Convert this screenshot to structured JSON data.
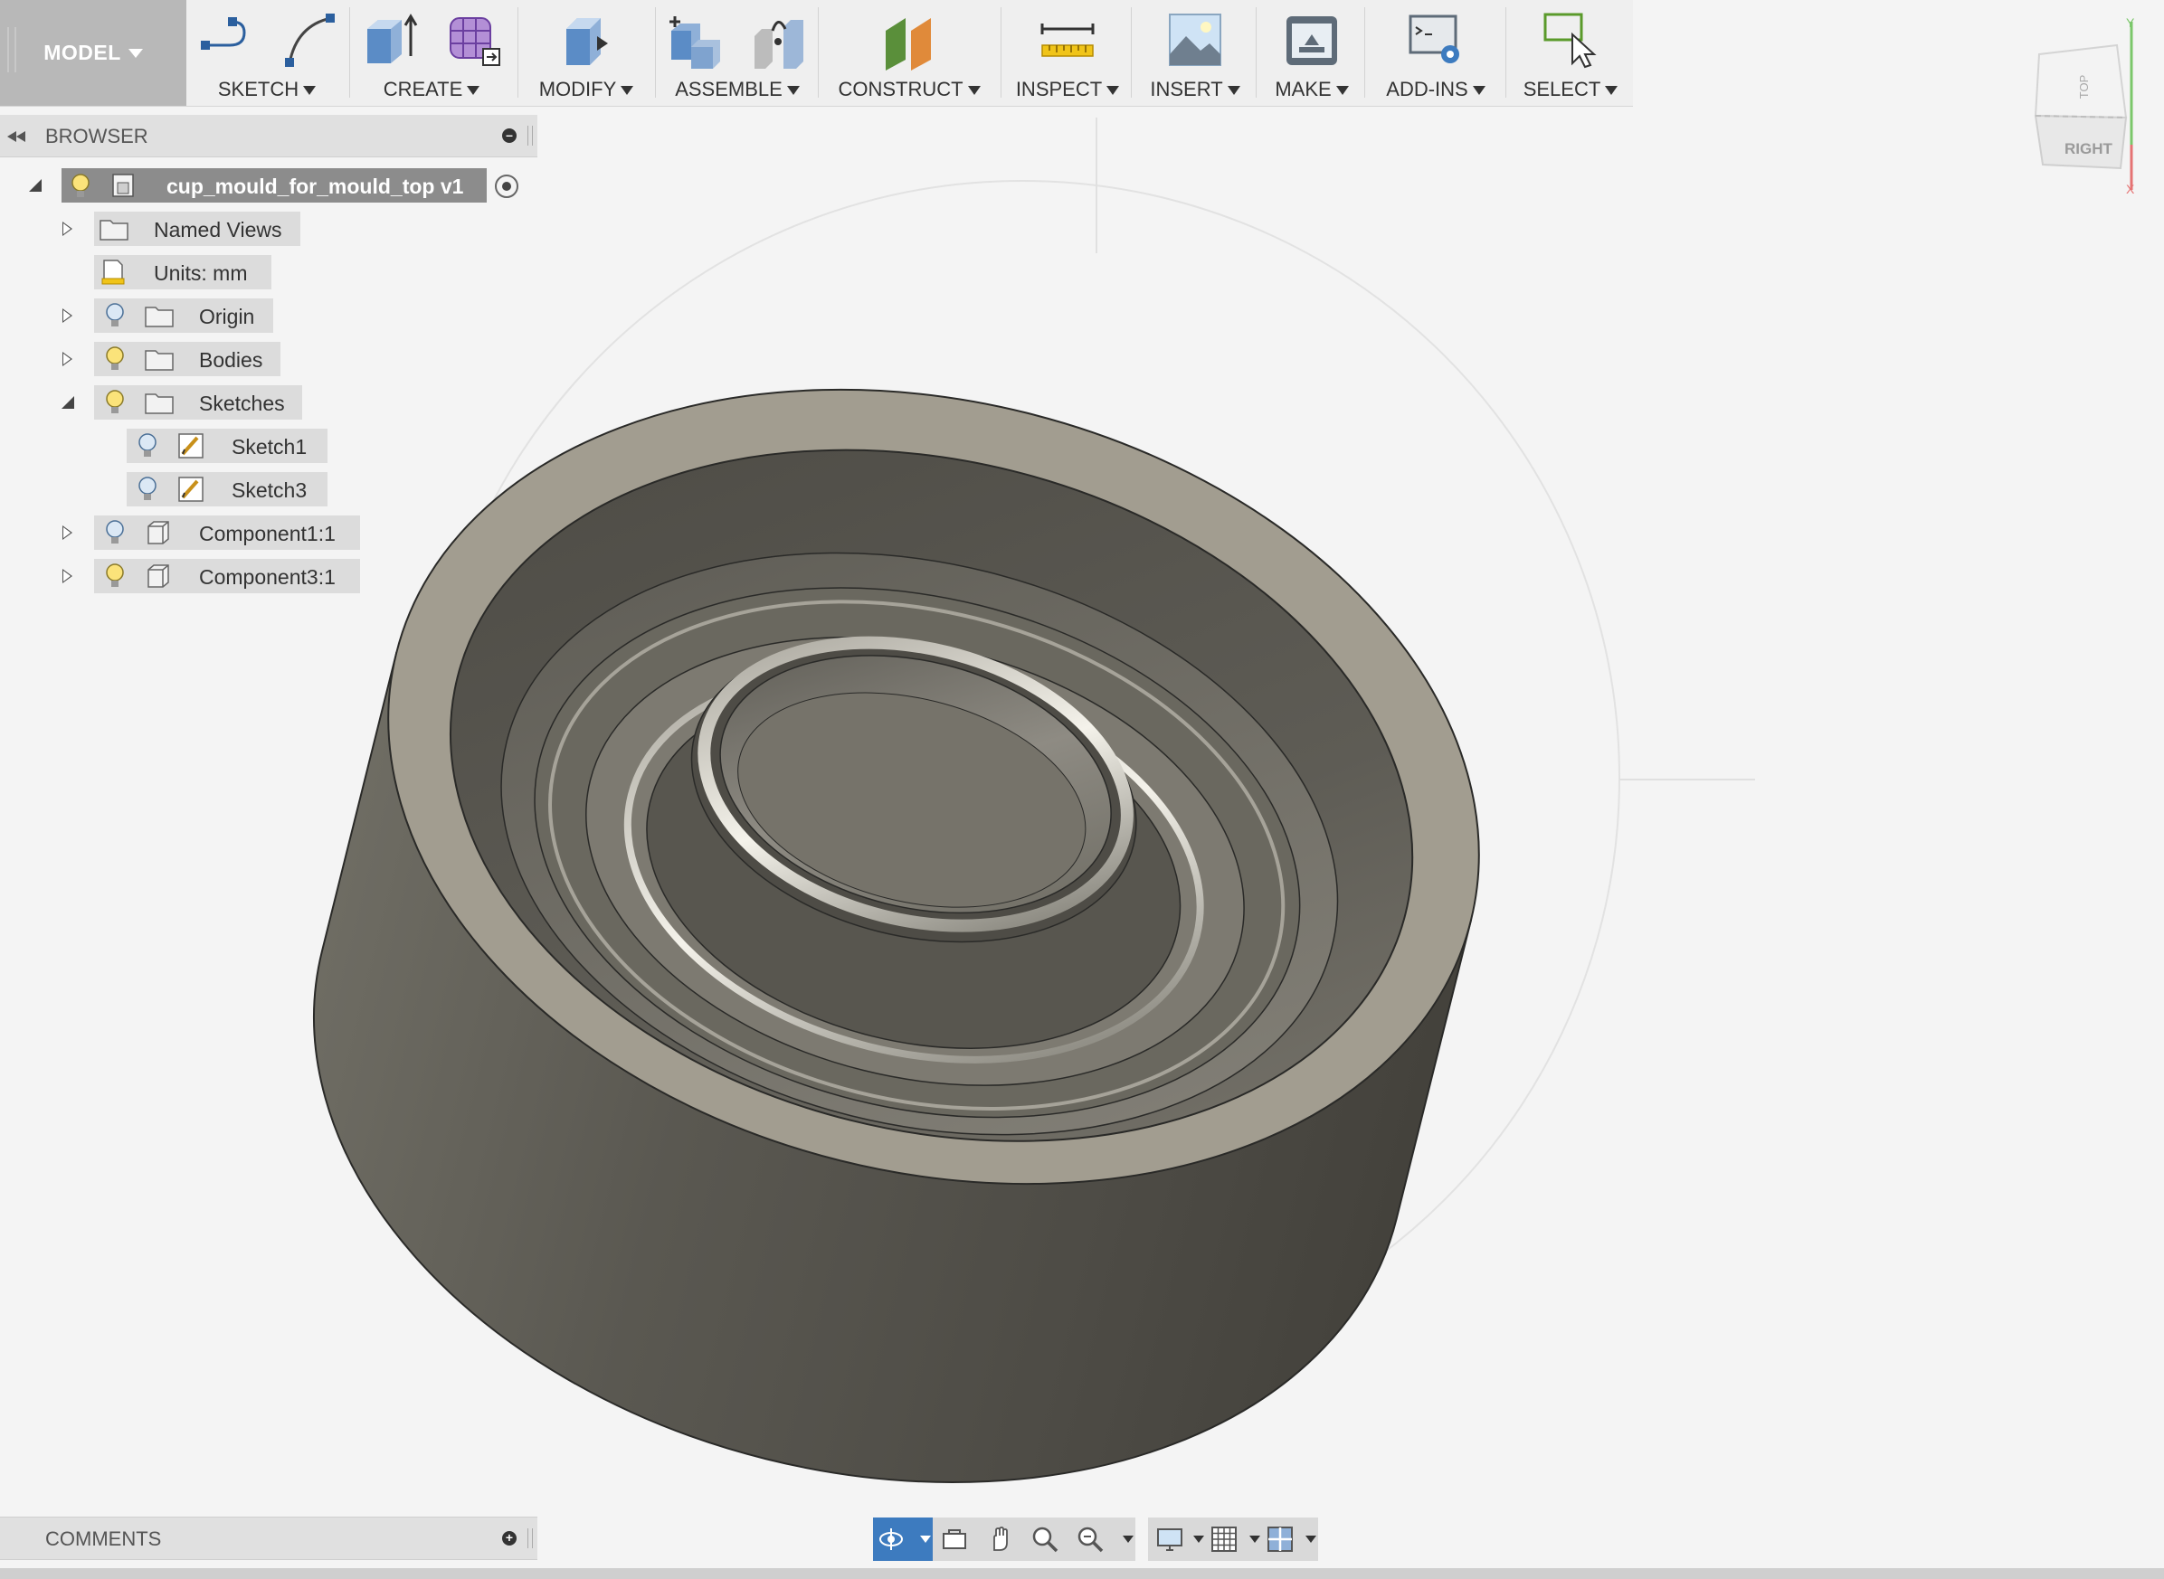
{
  "toolbar": {
    "model_label": "MODEL",
    "groups": [
      {
        "label": "SKETCH",
        "icons": [
          "line-icon",
          "arc-icon"
        ]
      },
      {
        "label": "CREATE",
        "icons": [
          "extrude-icon",
          "form-icon"
        ]
      },
      {
        "label": "MODIFY",
        "icons": [
          "press-pull-icon"
        ]
      },
      {
        "label": "ASSEMBLE",
        "icons": [
          "new-component-icon",
          "joint-icon"
        ]
      },
      {
        "label": "CONSTRUCT",
        "icons": [
          "offset-plane-icon"
        ]
      },
      {
        "label": "INSPECT",
        "icons": [
          "measure-icon"
        ]
      },
      {
        "label": "INSERT",
        "icons": [
          "insert-image-icon"
        ]
      },
      {
        "label": "MAKE",
        "icons": [
          "3d-print-icon"
        ]
      },
      {
        "label": "ADD-INS",
        "icons": [
          "scripts-icon"
        ]
      },
      {
        "label": "SELECT",
        "icons": [
          "select-icon"
        ]
      }
    ]
  },
  "browser": {
    "title": "BROWSER",
    "root": {
      "label": "cup_mould_for_mould_top v1"
    },
    "items": [
      {
        "label": "Named Views"
      },
      {
        "label": "Units: mm"
      },
      {
        "label": "Origin"
      },
      {
        "label": "Bodies"
      },
      {
        "label": "Sketches"
      },
      {
        "label": "Sketch1"
      },
      {
        "label": "Sketch3"
      },
      {
        "label": "Component1:1"
      },
      {
        "label": "Component3:1"
      }
    ]
  },
  "viewcube": {
    "face_label": "RIGHT",
    "top_label": "TOP",
    "axis_y": "Y",
    "axis_x": "X"
  },
  "comments": {
    "title": "COMMENTS"
  },
  "colors": {
    "toolbar_bg": "#efefef",
    "model_bg": "#b8b8b8",
    "panel_header_bg": "#e0e0e0",
    "selected_row_bg": "#8c8c8c",
    "nav_active": "#3d7bbf",
    "cup_rim": "#a29d90",
    "cup_wall": "#58564f"
  }
}
